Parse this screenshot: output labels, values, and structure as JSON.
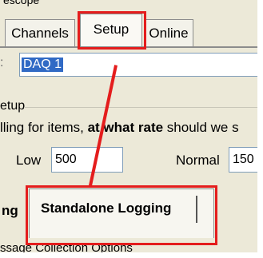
{
  "window": {
    "top_cut_text": "escope"
  },
  "tabs": [
    {
      "label": "Channels"
    },
    {
      "label": "Setup"
    },
    {
      "label": "Online"
    }
  ],
  "name_field": {
    "value": "DAQ 1"
  },
  "section_label": "etup",
  "prompt": {
    "prefix": "lling for items, ",
    "bold": "at what rate",
    "suffix": " should we s"
  },
  "rates": {
    "low_label": "Low",
    "low_value": "500",
    "normal_label": "Normal",
    "normal_value": "150"
  },
  "lower_tabs": {
    "left_cut": "ng",
    "standalone": "Standalone Logging"
  },
  "footer_cut": "ssage Collection Options",
  "annotation": {
    "color": "#e41d1d"
  }
}
